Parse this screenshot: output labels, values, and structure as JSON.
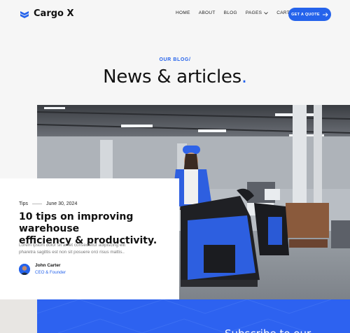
{
  "brand": {
    "name": "Cargo X",
    "accent": "#2563eb"
  },
  "nav": {
    "items": [
      {
        "label": "HOME"
      },
      {
        "label": "ABOUT"
      },
      {
        "label": "BLOG"
      },
      {
        "label": "PAGES"
      },
      {
        "label": "CART (0)"
      }
    ],
    "cta_label": "GET A QUOTE"
  },
  "hero": {
    "eyebrow": "OUR BLOG/",
    "title": "News & articles",
    "title_dot": "."
  },
  "post": {
    "category": "Tips",
    "date": "June 30, 2024",
    "title_line1": "10 tips on improving warehouse",
    "title_line2": "efficiency & productivity",
    "title_dot": ".",
    "excerpt_line1": "Lorem ipsum dolor sit amet consectetur adipiscing elit",
    "excerpt_line2": "pharetra sagittis est non sit posuere orci risus mattis..",
    "author_name": "John Carter",
    "author_role": "CEO & Founder"
  },
  "subscribe": {
    "heading": "Subscribe to our"
  }
}
